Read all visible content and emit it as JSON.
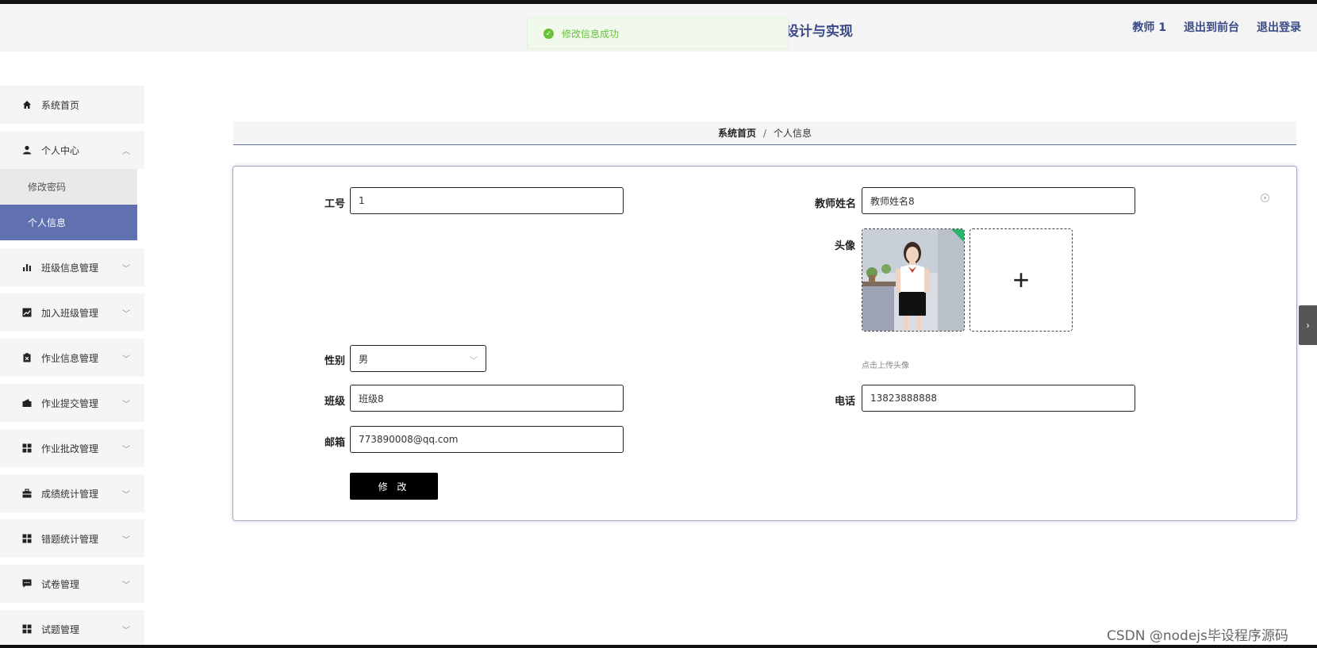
{
  "header": {
    "title": "设计与实现",
    "nav": [
      "教师 1",
      "退出到前台",
      "退出登录"
    ]
  },
  "toast": {
    "message": "修改信息成功"
  },
  "sidebar": {
    "items": [
      {
        "label": "系统首页",
        "icon": "home-icon"
      },
      {
        "label": "个人中心",
        "icon": "user-icon",
        "expanded": true,
        "children": [
          {
            "label": "修改密码"
          },
          {
            "label": "个人信息",
            "active": true
          }
        ]
      },
      {
        "label": "班级信息管理",
        "icon": "bar-chart-icon"
      },
      {
        "label": "加入班级管理",
        "icon": "line-chart-icon"
      },
      {
        "label": "作业信息管理",
        "icon": "clipboard-icon"
      },
      {
        "label": "作业提交管理",
        "icon": "wallet-icon"
      },
      {
        "label": "作业批改管理",
        "icon": "grid-icon"
      },
      {
        "label": "成绩统计管理",
        "icon": "briefcase-icon"
      },
      {
        "label": "错题统计管理",
        "icon": "grid-icon"
      },
      {
        "label": "试卷管理",
        "icon": "message-icon"
      },
      {
        "label": "试题管理",
        "icon": "grid-icon"
      }
    ]
  },
  "breadcrumb": {
    "home": "系统首页",
    "separator": "/",
    "current": "个人信息"
  },
  "form": {
    "employee_id": {
      "label": "工号",
      "value": "1"
    },
    "teacher_name": {
      "label": "教师姓名",
      "value": "教师姓名8"
    },
    "avatar": {
      "label": "头像",
      "hint": "点击上传头像"
    },
    "gender": {
      "label": "性别",
      "value": "男"
    },
    "class": {
      "label": "班级",
      "value": "班级8"
    },
    "phone": {
      "label": "电话",
      "value": "13823888888"
    },
    "email": {
      "label": "邮箱",
      "value": "773890008@qq.com"
    },
    "submit_label": "修 改"
  },
  "watermark": "CSDN @nodejs毕设程序源码"
}
